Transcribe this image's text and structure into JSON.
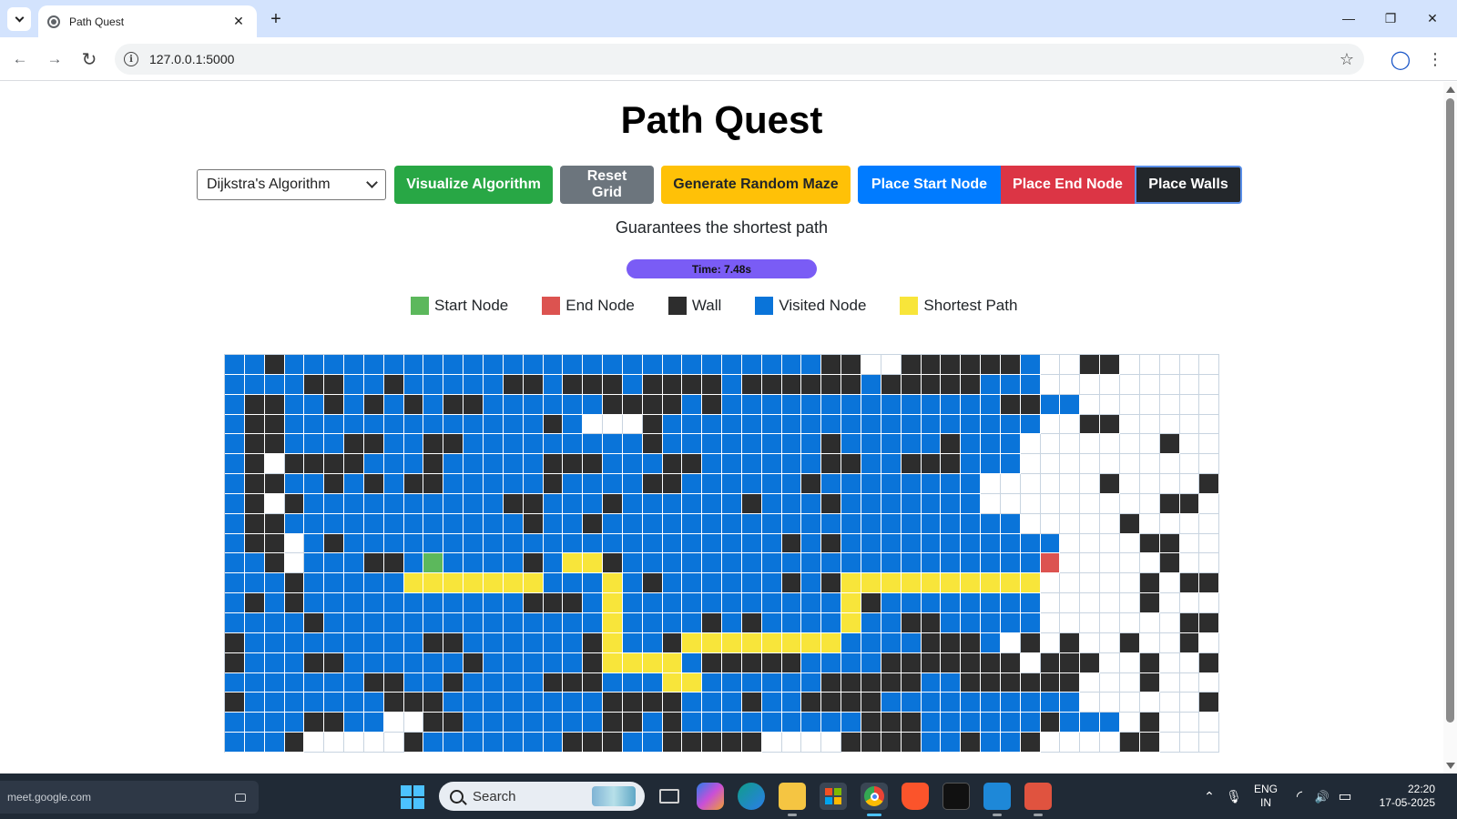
{
  "browser": {
    "tab_title": "Path Quest",
    "tab_close": "✕",
    "new_tab": "+",
    "url": "127.0.0.1:5000",
    "back": "←",
    "forward": "→",
    "reload": "↻",
    "info": "i",
    "star": "☆",
    "profile": "◯",
    "menu": "⋮",
    "minimize": "—",
    "restore": "❐",
    "close": "✕"
  },
  "app": {
    "title": "Path Quest",
    "algorithm_selected": "Dijkstra's Algorithm",
    "buttons": {
      "visualize": "Visualize Algorithm",
      "reset": "Reset Grid",
      "maze": "Generate Random Maze",
      "start": "Place Start Node",
      "end": "Place End Node",
      "walls": "Place Walls"
    },
    "description": "Guarantees the shortest path",
    "timer": "Time: 7.48s",
    "legend": [
      {
        "label": "Start Node",
        "color": "#5cb85c"
      },
      {
        "label": "End Node",
        "color": "#dc5350"
      },
      {
        "label": "Wall",
        "color": "#2d2d2d"
      },
      {
        "label": "Visited Node",
        "color": "#0a74d9"
      },
      {
        "label": "Shortest Path",
        "color": "#f8e53a"
      }
    ],
    "grid": {
      "legend_codes": {
        "v": "visited",
        "w": "wall",
        "p": "shortest-path",
        "s": "start",
        "e": "end",
        ".": "empty"
      },
      "rows": [
        "vvwvvvvvvvvvvvvvvvvvvvvvvvvvvvww..wwwwwwv..ww.....",
        "vvvvwwvvwvvvvvwwvwwwvwwwwvwwwwwwvwwwwwvvv.........",
        "vwwvvwvwvwvwwvvvvvvwwwwvwvvvvvvvvvvvvvvwwvv.......",
        "vwwvvvvvvvvvvvvvwv...wvvvvvvvvvvvvvvvvvvv..ww.....",
        "vwwvvvwwvvwwvvvvvvvvvwvvvvvvvvwvvvvvwvvv.......w..",
        "vw.wwwwvvvwvvvvvwwwvvvwwvvvvvvwwvvwwwvvv..........",
        "vwwvvwvwvwwvvvvvwvvvvwwvvvvvvwvvvvvvvv......w....w",
        "vw.wvvvvvvvvvvwwvvvwvvvvvvwvvvwvvvvvvv.........ww.",
        "vwwvvvvvvvvvvvvwvvwvvvvvvvvvvvvvvvvvvvvv.....w....",
        "vww.vwvvvvvvvvvvvvvvvvvvvvvvwvwvvvvvvvvvvv....ww..",
        "vvw.vvvwwvsvvvvwvppwvvvvvvvvvvvvvvvvvvvvve.....w..",
        "vvvwvvvvvpppppppvvvpvwvvvvvvwvwpppppppppp.....w.ww",
        "vwvwvvvvvvvvvvvwwwvpvvvvvvvvvvvpwvvvvvvvv.....w...",
        "vvvvwvvvvvvvvvvvvvvpvvvvwvwvvvvpvvwwvvvvv.......ww",
        "wvvvvvvvvvwwvvvvvvwpvvwppppppppvvvvwwwv.w.w..w..w.",
        "wvvvwwvvvvvvwvvvvvwppppvwwwwwvvvvwwwwwww.www..w..w",
        "vvvvvvvwwvvwvvvvwwwvvvppvvvvvvwwwwwvvwwwwww...w...",
        "wvvvvvvvwwwvvvvvvvvwwwwvvvwvvwwwwvvvvvvvvvv......w",
        "vvvvwwvv..wwvvvvvvvwwvwvvvvvvvvvwwwvvvvvvwvvv.w...",
        "vvvw.....wvvvvvvvwwwvvwwwww....wwwwvvwvvw....ww..."
      ]
    }
  },
  "taskbar": {
    "meet_label": "meet.google.com",
    "search_placeholder": "Search",
    "lang_top": "ENG",
    "lang_bottom": "IN",
    "time": "22:20",
    "date": "17-05-2025",
    "caret": "⌃",
    "mic": "🎙",
    "wifi": "◜",
    "volume": "🔊",
    "battery": "▭"
  }
}
